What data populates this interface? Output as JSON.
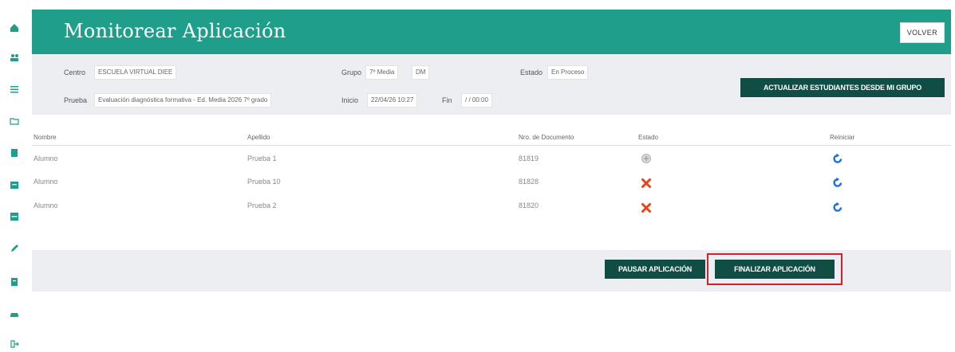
{
  "sidebar": {
    "icons": [
      "home-icon",
      "users-icon",
      "list-icon",
      "folder-icon",
      "document-icon",
      "calendar-icon",
      "grid-icon",
      "pencil-icon",
      "file-icon",
      "car-icon",
      "logout-icon"
    ]
  },
  "header": {
    "title": "Monitorear Aplicación",
    "back_label": "VOLVER"
  },
  "info": {
    "centro_label": "Centro",
    "centro_value": "ESCUELA VIRTUAL DIEE",
    "grupo_label": "Grupo",
    "grupo_value": "7º Media",
    "grupo_value2": "DM",
    "estado_label": "Estado",
    "estado_value": "En Proceso",
    "prueba_label": "Prueba",
    "prueba_value": "Evaluación diagnóstica formativa - Ed. Media 2026 7º grado",
    "inicio_label": "Inicio",
    "inicio_value": "22/04/26 10:27",
    "fin_label": "Fin",
    "fin_value": "/ / 00:00",
    "update_button": "ACTUALIZAR ESTUDIANTES DESDE MI GRUPO"
  },
  "table": {
    "headers": {
      "nombre": "Nombre",
      "apellido": "Apellido",
      "documento": "Nro. de Documento",
      "estado": "Estado",
      "reiniciar": "Reiniciar"
    },
    "rows": [
      {
        "nombre": "Alumno",
        "apellido": "Prueba 1",
        "documento": "81819",
        "estado": "in-progress"
      },
      {
        "nombre": "Alumno",
        "apellido": "Prueba 10",
        "documento": "81828",
        "estado": "not-started"
      },
      {
        "nombre": "Alumno",
        "apellido": "Prueba 2",
        "documento": "81820",
        "estado": "not-started"
      }
    ]
  },
  "footer": {
    "pause_button": "PAUSAR APLICACIÓN",
    "finish_button": "FINALIZAR APLICACIÓN"
  },
  "colors": {
    "header_teal": "#1f9e8c",
    "dark_button": "#0f4d45",
    "status_x": "#e8431c",
    "reset_blue": "#1e6fd9",
    "highlight_red": "#d61f2b"
  }
}
